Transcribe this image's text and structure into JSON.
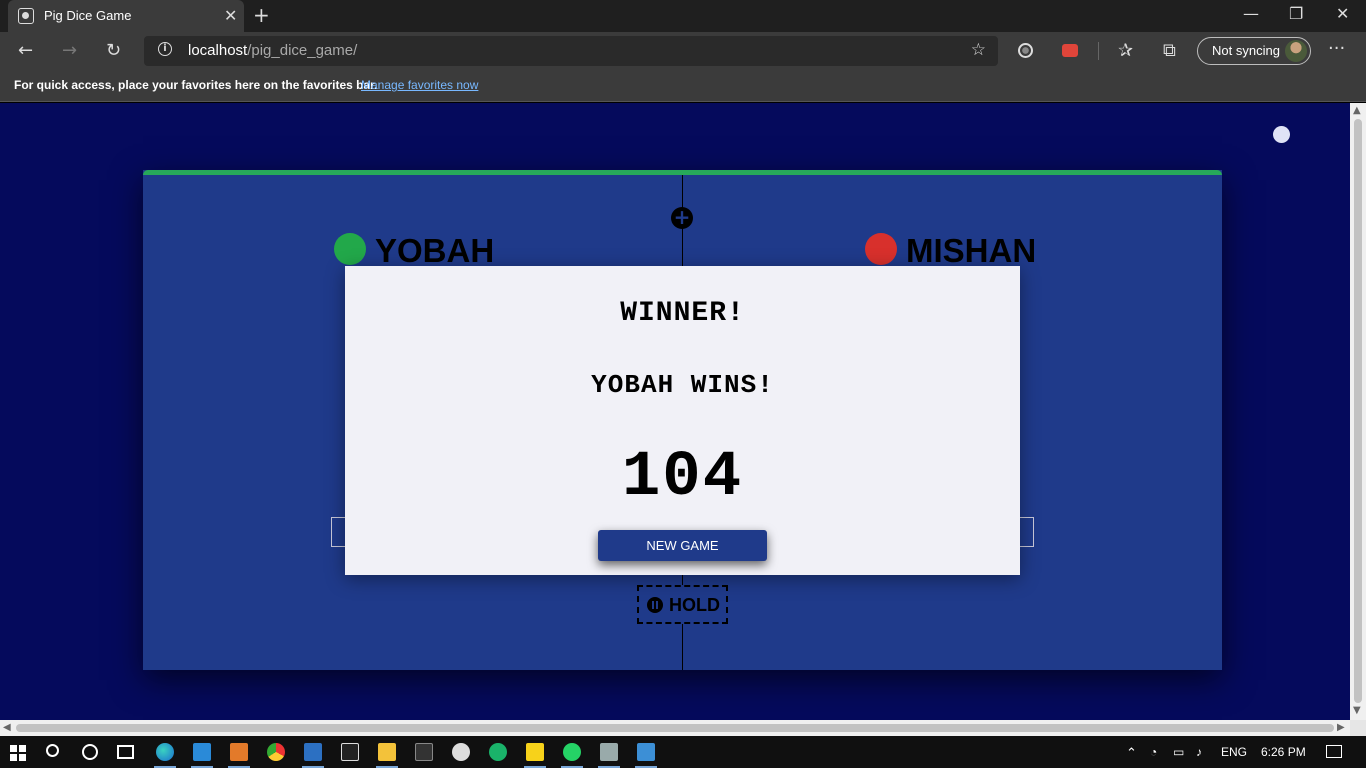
{
  "browser": {
    "tab": {
      "title": "Pig Dice Game",
      "close_glyph": "✕",
      "favicon": "pig-icon"
    },
    "new_tab_glyph": "+",
    "window_controls": {
      "minimize": "—",
      "restore": "❐",
      "close": "✕"
    },
    "toolbar": {
      "back": "←",
      "forward": "→",
      "refresh": "↻",
      "address_host": "localhost",
      "address_path": "/pig_dice_game/",
      "info_glyph": "i",
      "star_glyph": "☆",
      "favorites_glyph": "✰",
      "collections_glyph": "⧉",
      "more_glyph": "···",
      "sync_label": "Not syncing"
    },
    "favorites_bar": {
      "text": "For quick access, place your favorites here on the favorites bar.",
      "link": "Manage favorites now"
    }
  },
  "game": {
    "roll_glyph": "+",
    "players": [
      {
        "name": "YOBAH",
        "color": "#22a84a"
      },
      {
        "name": "MISHAN",
        "color": "#d8302c"
      }
    ],
    "hold_label": "HOLD",
    "modal": {
      "title": "WINNER!",
      "winner_text": "YOBAH WINS!",
      "score": "104",
      "new_game_label": "NEW GAME"
    }
  },
  "taskbar": {
    "language": "ENG",
    "time": "6:26 PM"
  }
}
